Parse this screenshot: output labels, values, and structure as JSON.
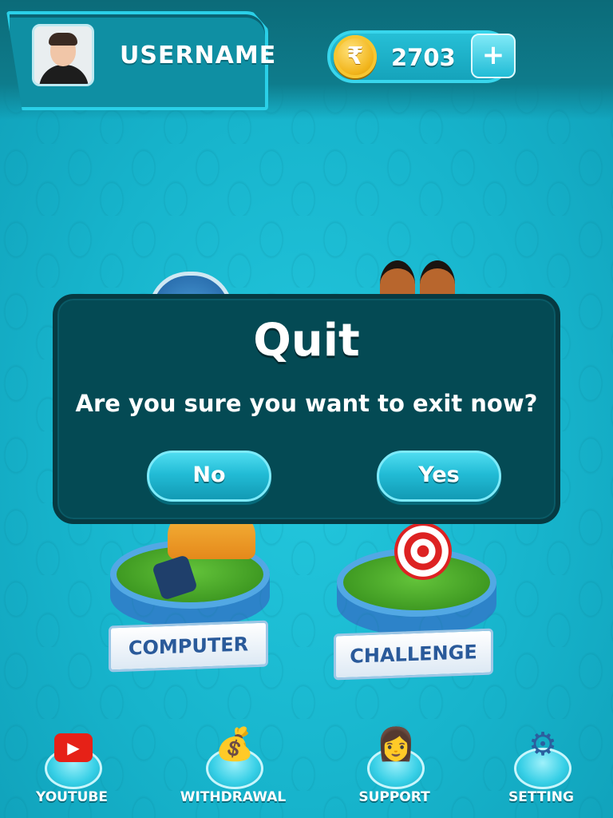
{
  "header": {
    "username": "USERNAME",
    "coins": "2703",
    "coin_symbol": "₹",
    "plus_label": "+"
  },
  "modes": {
    "computer_label": "COMPUTER",
    "challenge_label": "CHALLENGE"
  },
  "dialog": {
    "title": "Quit",
    "message": "Are you sure you want to exit now?",
    "no_label": "No",
    "yes_label": "Yes"
  },
  "nav": {
    "items": [
      {
        "label": "YOUTUBE",
        "icon": "youtube-icon"
      },
      {
        "label": "WITHDRAWAL",
        "icon": "money-bag-icon"
      },
      {
        "label": "SUPPORT",
        "icon": "support-agent-icon"
      },
      {
        "label": "SETTING",
        "icon": "gear-icon"
      }
    ]
  },
  "colors": {
    "background": "#17b4cc",
    "dialog_bg": "#044a54",
    "button": "#22bcd6",
    "coin": "#f2b51c"
  }
}
